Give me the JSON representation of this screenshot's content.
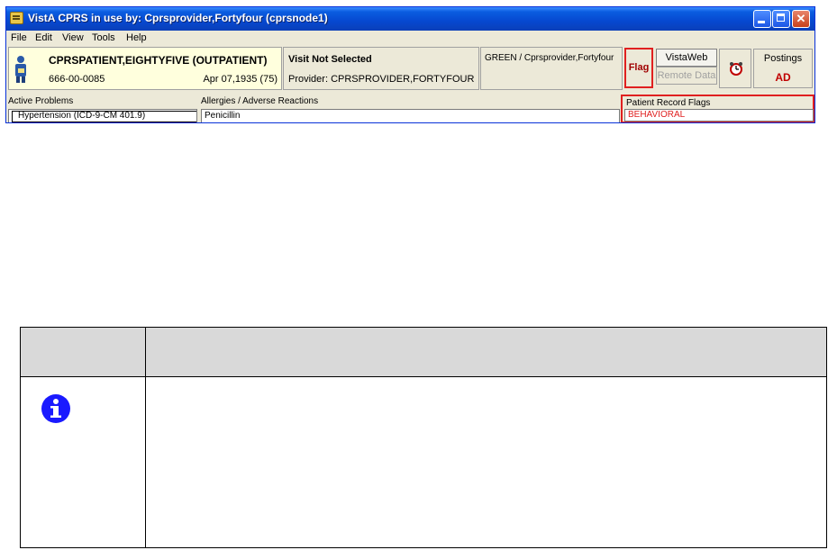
{
  "window": {
    "title": "VistA CPRS in use by: Cprsprovider,Fortyfour  (cprsnode1)"
  },
  "menu": [
    "File",
    "Edit",
    "View",
    "Tools",
    "Help"
  ],
  "patient": {
    "name": "CPRSPATIENT,EIGHTYFIVE (OUTPATIENT)",
    "ssn": "666-00-0085",
    "dob": "Apr 07,1935 (75)"
  },
  "visit": {
    "title": "Visit Not Selected",
    "provider": "Provider:  CPRSPROVIDER,FORTYFOUR"
  },
  "team": "GREEN / Cprsprovider,Fortyfour",
  "buttons": {
    "flag": "Flag",
    "vistaweb": "VistaWeb",
    "remote_data": "Remote Data",
    "postings": "Postings",
    "postings_code": "AD"
  },
  "problems": {
    "label": "Active Problems",
    "items": [
      "Hypertension (ICD-9-CM 401.9)"
    ]
  },
  "allergies": {
    "label": "Allergies / Adverse Reactions",
    "items": [
      "Penicillin"
    ]
  },
  "record_flags": {
    "label": "Patient Record Flags",
    "items": [
      "BEHAVIORAL"
    ]
  },
  "colors": {
    "highlight": "#e02020",
    "titlebar": "#0a5ce0",
    "patient_bg": "#ffffdd",
    "note_icon": "#1a1aff"
  }
}
